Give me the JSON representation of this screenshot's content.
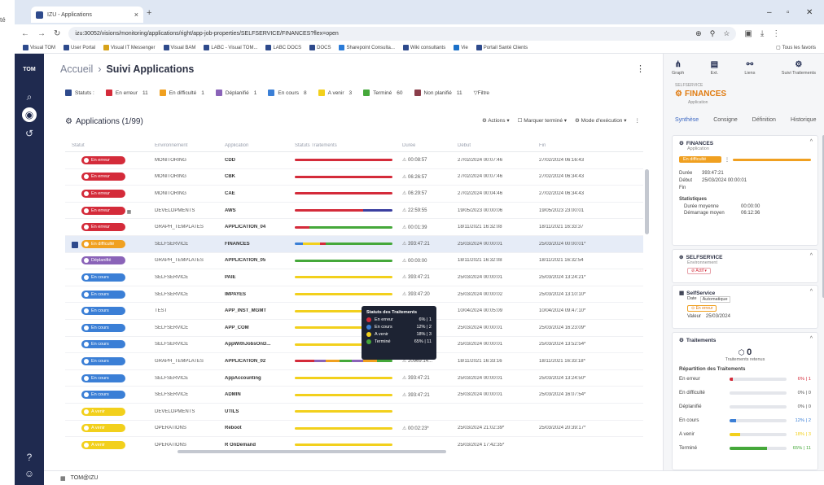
{
  "browser": {
    "tab_title": "IZU - Applications",
    "new_tab": "+",
    "url": "izu:30052/visions/monitoring/applications/right/app-job-properties/SELFSERVICE/FINANCES?flex=open",
    "bookmarks": [
      "Visual TOM",
      "User Portal",
      "Visual IT Messenger",
      "Visual BAM",
      "LABC - Visual TOM...",
      "LABC DOCS",
      "DOCS",
      "Sharepoint Consulta...",
      "Wiki consultants",
      "Vie",
      "Portail Santé Clients"
    ],
    "bookmarks_right": "Tous les favoris",
    "bookmark_colors": [
      "#2e4a8c",
      "#2e4a8c",
      "#d7a21a",
      "#2e4a8c",
      "#2e4a8c",
      "#2e4a8c",
      "#2e4a8c",
      "#2a7bd8",
      "#2e4a8c",
      "#1a70c8",
      "#2e4a8c"
    ]
  },
  "outer": {
    "fragment": "té"
  },
  "nav": {
    "logo": "TOM",
    "items": [
      "search-icon",
      "monitor-icon",
      "history-icon",
      "help-icon",
      "user-icon"
    ]
  },
  "header": {
    "breadcrumb_home": "Accueil",
    "breadcrumb_sep": "›",
    "breadcrumb_page": "Suivi Applications",
    "menu": "⋮"
  },
  "filters": {
    "label": "Statuts :",
    "items": [
      {
        "label": "En erreur",
        "count": "11",
        "color": "#d42b3a"
      },
      {
        "label": "En difficulté",
        "count": "1",
        "color": "#f0a020"
      },
      {
        "label": "Déplanifié",
        "count": "1",
        "color": "#8a63b8"
      },
      {
        "label": "En cours",
        "count": "8",
        "color": "#3b7fd6"
      },
      {
        "label": "A venir",
        "count": "3",
        "color": "#f2d01c"
      },
      {
        "label": "Terminé",
        "count": "60",
        "color": "#45a83a"
      },
      {
        "label": "Non planifié",
        "count": "11",
        "color": "#8a3e4a"
      }
    ],
    "filter_label": "Filtre"
  },
  "apps_header": {
    "title": "Applications (1/99)",
    "actions": "Actions",
    "mark_done": "Marquer terminé",
    "mode": "Mode d'exécution"
  },
  "table": {
    "columns": [
      "Statut",
      "Environnement",
      "Application",
      "Statuts Traitements",
      "Durée",
      "Début",
      "Fin"
    ],
    "rows": [
      {
        "status": "En erreur",
        "color": "#d42b3a",
        "env": "MONITORING",
        "app": "CDD",
        "dur": "00:08:57",
        "start": "27/02/2024 00:07:46",
        "end": "27/02/2024 06:16:43",
        "bar": [
          [
            100,
            "#d42b3a"
          ]
        ]
      },
      {
        "status": "En erreur",
        "color": "#d42b3a",
        "env": "MONITORING",
        "app": "CBK",
        "dur": "06:26:57",
        "start": "27/02/2024 00:07:46",
        "end": "27/02/2024 06:34:43",
        "bar": [
          [
            100,
            "#d42b3a"
          ]
        ]
      },
      {
        "status": "En erreur",
        "color": "#d42b3a",
        "env": "MONITORING",
        "app": "CAE",
        "dur": "06:29:57",
        "start": "27/02/2024 00:04:46",
        "end": "27/02/2024 06:34:43",
        "bar": [
          [
            100,
            "#d42b3a"
          ]
        ]
      },
      {
        "status": "En erreur",
        "color": "#d42b3a",
        "env": "DEVELOPMENTS",
        "app": "AWS",
        "dur": "22:59:55",
        "start": "19/05/2023 00:00:06",
        "end": "19/05/2023 23:00:01",
        "bar": [
          [
            70,
            "#d42b3a"
          ],
          [
            30,
            "#3b3fa0"
          ]
        ]
      },
      {
        "status": "En erreur",
        "color": "#d42b3a",
        "env": "GRAPH_TEMPLATES",
        "app": "APPLICATION_04",
        "dur": "00:01:39",
        "start": "18/11/2021 16:32:08",
        "end": "18/11/2021 16:33:37",
        "bar": [
          [
            15,
            "#d42b3a"
          ],
          [
            85,
            "#45a83a"
          ]
        ]
      },
      {
        "status": "En difficulté",
        "color": "#f0a020",
        "env": "SELFSERVICE",
        "app": "FINANCES",
        "dur": "393:47:21",
        "start": "25/03/2024 00:00:01",
        "end": "25/03/2024 00:00:01*",
        "bar": [
          [
            8,
            "#3b7fd6"
          ],
          [
            18,
            "#f2d01c"
          ],
          [
            6,
            "#d42b3a"
          ],
          [
            68,
            "#45a83a"
          ]
        ]
      },
      {
        "status": "Déplanifié",
        "color": "#8a63b8",
        "env": "GRAPH_TEMPLATES",
        "app": "APPLICATION_05",
        "dur": "00:00:00",
        "start": "18/11/2021 16:32:08",
        "end": "18/11/2021 16:32:54",
        "bar": [
          [
            100,
            "#45a83a"
          ]
        ]
      },
      {
        "status": "En cours",
        "color": "#3b7fd6",
        "env": "SELFSERVICE",
        "app": "PAIE",
        "dur": "393:47:21",
        "start": "25/03/2024 00:00:01",
        "end": "25/03/2024 13:24:21*",
        "bar": [
          [
            100,
            "#f2d01c"
          ]
        ]
      },
      {
        "status": "En cours",
        "color": "#3b7fd6",
        "env": "SELFSERVICE",
        "app": "IMPAYES",
        "dur": "393:47:20",
        "start": "25/03/2024 00:00:02",
        "end": "25/03/2024 13:10:10*",
        "bar": [
          [
            100,
            "#f2d01c"
          ]
        ]
      },
      {
        "status": "En cours",
        "color": "#3b7fd6",
        "env": "TEST",
        "app": "APP_INST_MGMT",
        "dur": "09:41:48",
        "start": "10/04/2024 00:05:09",
        "end": "10/04/2024 09:47:10*",
        "bar": [
          [
            100,
            "#f2d01c"
          ]
        ]
      },
      {
        "status": "En cours",
        "color": "#3b7fd6",
        "env": "SELFSERVICE",
        "app": "APP_COM",
        "dur": "393:47:21",
        "start": "25/03/2024 00:00:01",
        "end": "25/03/2024 16:23:09*",
        "bar": [
          [
            100,
            "#f2d01c"
          ]
        ]
      },
      {
        "status": "En cours",
        "color": "#3b7fd6",
        "env": "SELFSERVICE",
        "app": "AppWithJobsOnD...",
        "dur": "393:47:21",
        "start": "25/03/2024 00:00:01",
        "end": "25/03/2024 13:52:54*",
        "bar": [
          [
            100,
            "#f2d01c"
          ]
        ]
      },
      {
        "status": "En cours",
        "color": "#3b7fd6",
        "env": "GRAPH_TEMPLATES",
        "app": "APPLICATION_02",
        "dur": "20969:14...",
        "start": "18/11/2021 16:33:16",
        "end": "18/11/2021 16:33:18*",
        "bar": [
          [
            20,
            "#d42b3a"
          ],
          [
            12,
            "#8a63b8"
          ],
          [
            14,
            "#f0a020"
          ],
          [
            12,
            "#45a83a"
          ],
          [
            12,
            "#8a63b8"
          ],
          [
            14,
            "#f0a020"
          ],
          [
            16,
            "#45a83a"
          ]
        ]
      },
      {
        "status": "En cours",
        "color": "#3b7fd6",
        "env": "SELFSERVICE",
        "app": "AppAccounting",
        "dur": "393:47:21",
        "start": "25/03/2024 00:00:01",
        "end": "25/03/2024 13:24:50*",
        "bar": [
          [
            100,
            "#f2d01c"
          ]
        ]
      },
      {
        "status": "En cours",
        "color": "#3b7fd6",
        "env": "SELFSERVICE",
        "app": "ADMIN",
        "dur": "393:47:21",
        "start": "25/03/2024 00:00:01",
        "end": "25/03/2024 16:07:54*",
        "bar": [
          [
            100,
            "#f2d01c"
          ]
        ]
      },
      {
        "status": "A venir",
        "color": "#f2d01c",
        "env": "DEVELOPMENTS",
        "app": "UTILS",
        "dur": "",
        "start": "",
        "end": "",
        "bar": [
          [
            100,
            "#f2d01c"
          ]
        ]
      },
      {
        "status": "A venir",
        "color": "#f2d01c",
        "env": "OPERATIONS",
        "app": "Reboot",
        "dur": "00:02:23*",
        "start": "25/03/2024 21:02:39*",
        "end": "25/03/2024 20:39:17*",
        "bar": [
          [
            100,
            "#f2d01c"
          ]
        ]
      },
      {
        "status": "A venir",
        "color": "#f2d01c",
        "env": "OPERATIONS",
        "app": "R OnDemand",
        "dur": "",
        "start": "25/03/2024 17:42:35*",
        "end": "",
        "bar": [
          [
            100,
            "#f2d01c"
          ]
        ]
      }
    ]
  },
  "tooltip": {
    "title": "Statuts des Traitements",
    "rows": [
      {
        "label": "En erreur",
        "value": "6% | 1",
        "color": "#d42b3a"
      },
      {
        "label": "En cours",
        "value": "12% | 2",
        "color": "#3b7fd6"
      },
      {
        "label": "A venir",
        "value": "18% | 3",
        "color": "#f2d01c"
      },
      {
        "label": "Terminé",
        "value": "65% | 11",
        "color": "#45a83a"
      }
    ]
  },
  "footer": {
    "user": "TOM@IZU"
  },
  "panel": {
    "toolbar": [
      {
        "icon": "graph-icon",
        "label": "Graph"
      },
      {
        "icon": "ext-icon",
        "label": "Ext."
      },
      {
        "icon": "link-icon",
        "label": "Liens"
      },
      {
        "icon": "jobs-icon",
        "label": "Suivi Traitements"
      }
    ],
    "env": "SELFSERVICE",
    "title": "FINANCES",
    "subtitle": "Application",
    "tabs": [
      "Synthèse",
      "Consigne",
      "Définition",
      "Historique"
    ],
    "app_card": {
      "title": "FINANCES",
      "sub": "Application",
      "status": "En difficulté",
      "dur_label": "Durée",
      "dur": "393:47:21",
      "start_label": "Début",
      "start": "25/03/2024 00:00:01",
      "end_label": "Fin",
      "stats": "Statistiques",
      "avg_label": "Durée moyenne",
      "avg": "00:00:00",
      "mean_label": "Démarrage moyen",
      "mean": "06:12:36"
    },
    "env_card": {
      "title": "SELFSERVICE",
      "sub": "Environnement",
      "badge": "Actif"
    },
    "ss_card": {
      "title": "SelfService",
      "date_label": "Date",
      "date_val": "Automatique",
      "badge": "En erreur",
      "val_label": "Valeur",
      "val": "25/03/2024"
    },
    "jobs_card": {
      "title": "Traitements",
      "count": "0",
      "retained": "Traitements retenus",
      "dist_title": "Répartition des Traitements",
      "dist": [
        {
          "label": "En erreur",
          "pct": "6% | 1",
          "fill": 0.06,
          "color": "#d42b3a"
        },
        {
          "label": "En difficulté",
          "pct": "0% | 0",
          "fill": 0,
          "color": "#f0a020"
        },
        {
          "label": "Déplanifié",
          "pct": "0% | 0",
          "fill": 0,
          "color": "#8a63b8"
        },
        {
          "label": "En cours",
          "pct": "12% | 2",
          "fill": 0.12,
          "color": "#3b7fd6"
        },
        {
          "label": "A venir",
          "pct": "18% | 3",
          "fill": 0.18,
          "color": "#f2d01c"
        },
        {
          "label": "Terminé",
          "pct": "65% | 11",
          "fill": 0.65,
          "color": "#45a83a"
        }
      ]
    }
  }
}
